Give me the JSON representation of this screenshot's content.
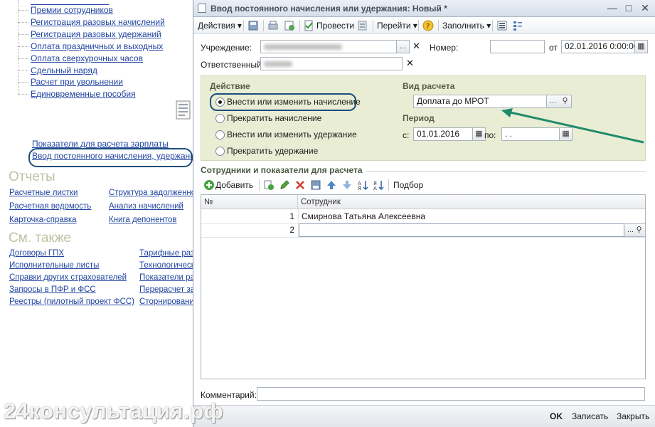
{
  "left_panel": {
    "tree_items": [
      "Премии сотрудников",
      "Регистрация разовых начислений",
      "Регистрация разовых удержаний",
      "Оплата праздничных и выходных",
      "Оплата сверхурочных часов",
      "Сдельный наряд",
      "Расчет при увольнении",
      "Единовременные пособия"
    ],
    "links_extra": [
      "Показатели для расчета зарплаты",
      "Ввод постоянного начисления, удержания"
    ],
    "reports_title": "Отчеты",
    "reports_left": [
      "Расчетные листки",
      "Расчетная ведомость",
      "Карточка-справка"
    ],
    "reports_right": [
      "Структура задолженности",
      "Анализ начислений",
      "Книга депонентов"
    ],
    "see_also_title": "См. также",
    "see_also_left": [
      "Договоры ГПХ",
      "Исполнительные листы",
      "Справки других страхователей",
      "Запросы в ПФР и ФСС",
      "Реестры (пилотный проект ФСС)"
    ],
    "see_also_right": [
      "Тарифные разряды",
      "Технологические",
      "Показатели расчета",
      "Перерасчет зарплаты",
      "Сторнирование"
    ]
  },
  "dialog": {
    "title": "Ввод постоянного начисления или удержания: Новый *",
    "toolbar": {
      "actions": "Действия ▾",
      "post": "Провести",
      "goto": "Перейти ▾",
      "fill": "Заполнить ▾"
    },
    "institution_label": "Учреждение:",
    "responsible_label": "Ответственный:",
    "number_label": "Номер:",
    "number_value": "",
    "from_label": "от",
    "date_value": "02.01.2016  0:00:00",
    "action_group_title": "Действие",
    "radio_options": [
      {
        "label": "Внести или изменить начисление",
        "selected": true
      },
      {
        "label": "Прекратить начисление",
        "selected": false
      },
      {
        "label": "Внести или изменить удержание",
        "selected": false
      },
      {
        "label": "Прекратить удержание",
        "selected": false
      }
    ],
    "calc_type_title": "Вид расчета",
    "calc_type_value": "Доплата до МРОТ",
    "period_title": "Период",
    "period_from_label": "с:",
    "period_from_value": "01.01.2016",
    "period_to_label": "по:",
    "period_to_value": " .  .",
    "employees_section_title": "Сотрудники и показатели для расчета",
    "table_toolbar": {
      "add": "Добавить",
      "pick": "Подбор"
    },
    "table_columns": {
      "num": "№",
      "employee": "Сотрудник"
    },
    "rows": [
      {
        "num": "1",
        "employee": "Смирнова Татьяна Алексеевна"
      },
      {
        "num": "2",
        "employee": ""
      }
    ],
    "comment_label": "Комментарий:",
    "comment_value": "",
    "buttons": {
      "ok": "OK",
      "save": "Записать",
      "close": "Закрыть"
    }
  },
  "watermark": "24консультация.рф",
  "colors": {
    "link": "#2044a0",
    "group_bg": "#e8edd4",
    "highlight_oval": "#1c4e7e",
    "arrow": "#1f8a6a"
  }
}
